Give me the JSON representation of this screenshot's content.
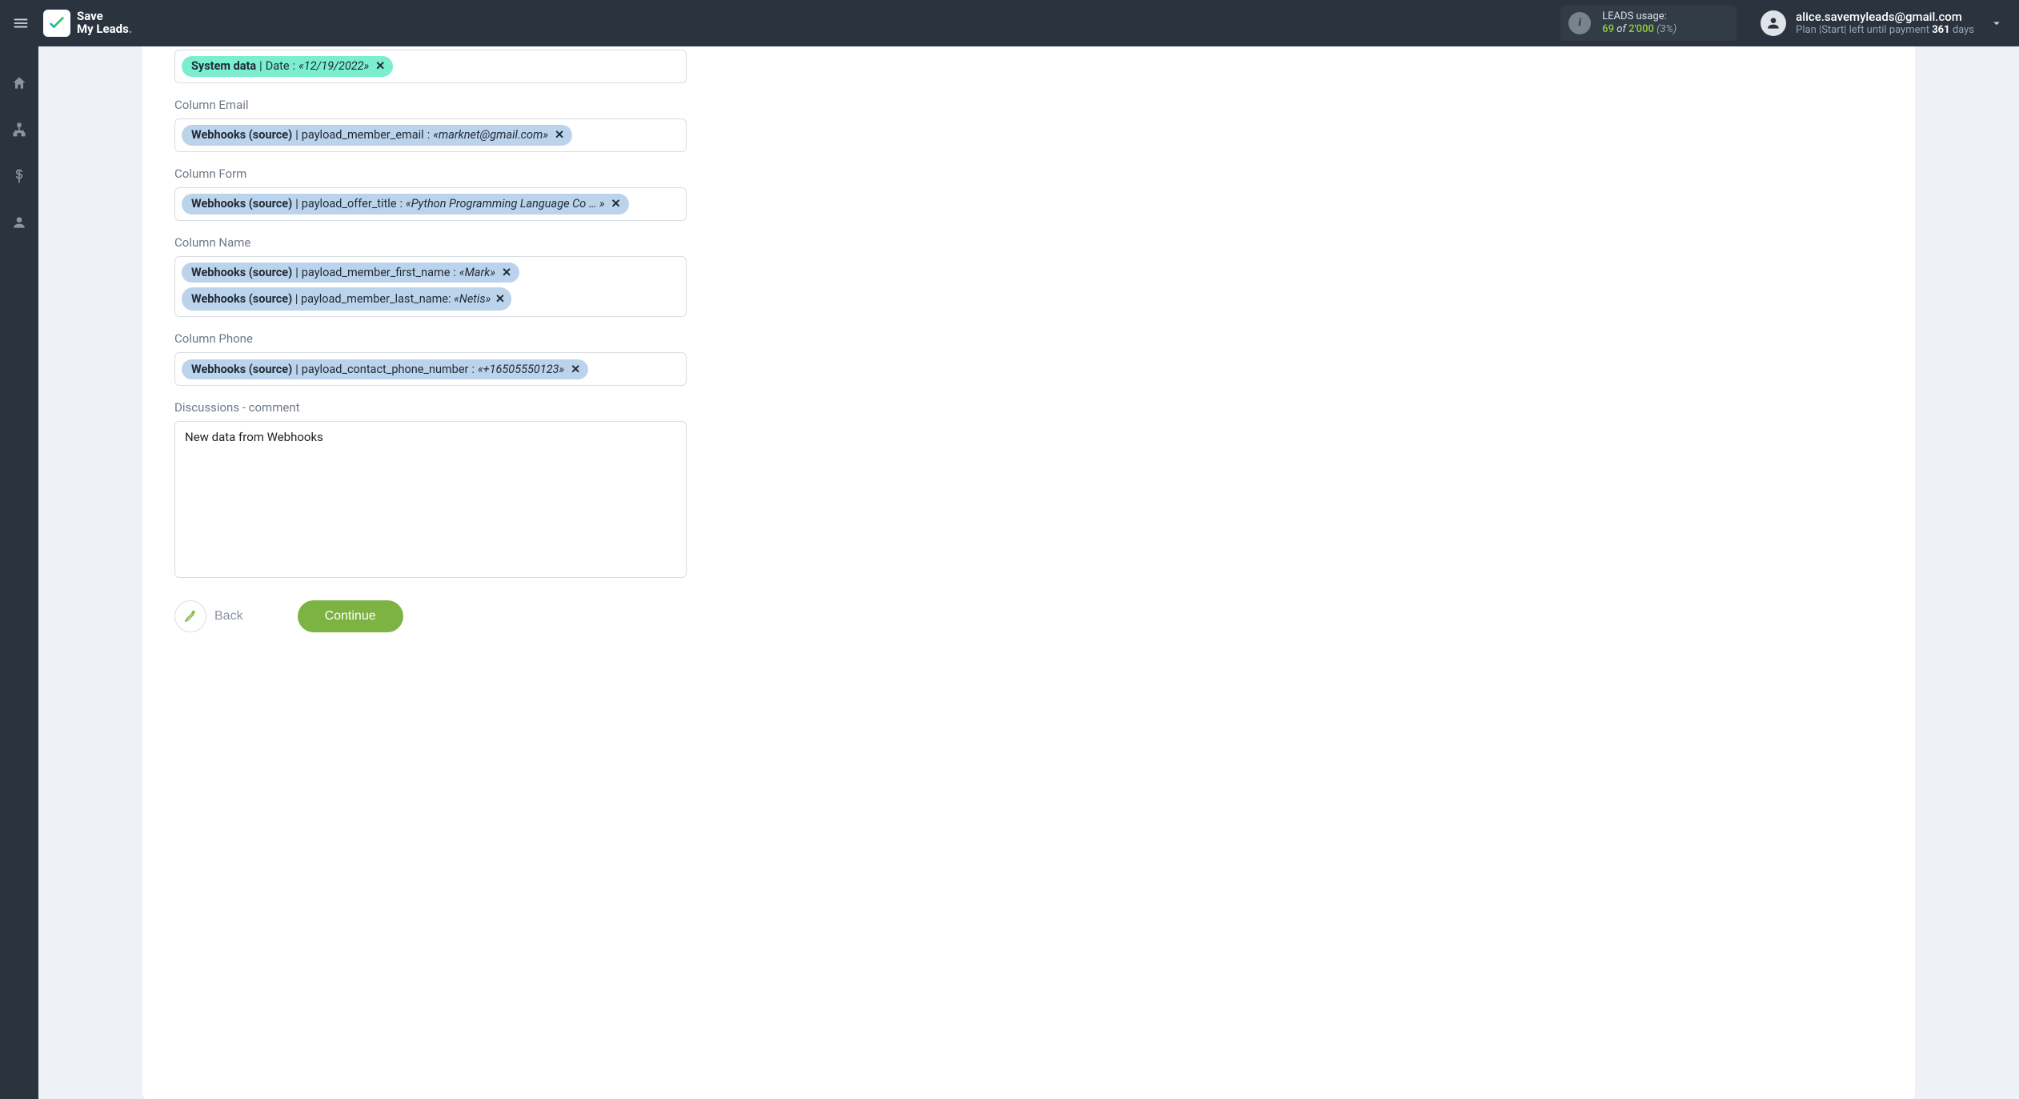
{
  "brand": {
    "line1": "Save",
    "line2": "My Leads"
  },
  "leads_usage": {
    "label": "LEADS usage:",
    "used": "69",
    "of_word": "of",
    "total": "2'000",
    "pct": "(3%)"
  },
  "user": {
    "email": "alice.savemyleads@gmail.com",
    "plan_prefix": "Plan |",
    "plan_name": "Start",
    "plan_mid": "| left until payment ",
    "days": "361",
    "days_word": " days"
  },
  "sidebar_icons": [
    "home",
    "sitemap",
    "dollar",
    "person"
  ],
  "form": {
    "field_date": {
      "tags": [
        {
          "source": "System data",
          "field": "Date",
          "example": "12/19/2022",
          "color": "teal"
        }
      ]
    },
    "field_email": {
      "label": "Column Email",
      "tags": [
        {
          "source": "Webhooks (source)",
          "field": "payload_member_email",
          "example": "marknet@gmail.com",
          "color": "blue"
        }
      ]
    },
    "field_form": {
      "label": "Column Form",
      "tags": [
        {
          "source": "Webhooks (source)",
          "field": "payload_offer_title",
          "example": "Python Programming Language Co … ",
          "color": "blue"
        }
      ]
    },
    "field_name": {
      "label": "Column Name",
      "tags": [
        {
          "source": "Webhooks (source)",
          "field": "payload_member_first_name",
          "example": "Mark",
          "color": "blue"
        },
        {
          "source": "Webhooks (source)",
          "field": "payload_member_last_name",
          "example": "Netis",
          "color": "blue",
          "wrap": true
        }
      ]
    },
    "field_phone": {
      "label": "Column Phone",
      "tags": [
        {
          "source": "Webhooks (source)",
          "field": "payload_contact_phone_number",
          "example": "+16505550123",
          "color": "blue"
        }
      ]
    },
    "field_discussions": {
      "label": "Discussions - comment",
      "value": "New data from Webhooks"
    }
  },
  "buttons": {
    "back": "Back",
    "continue": "Continue"
  }
}
